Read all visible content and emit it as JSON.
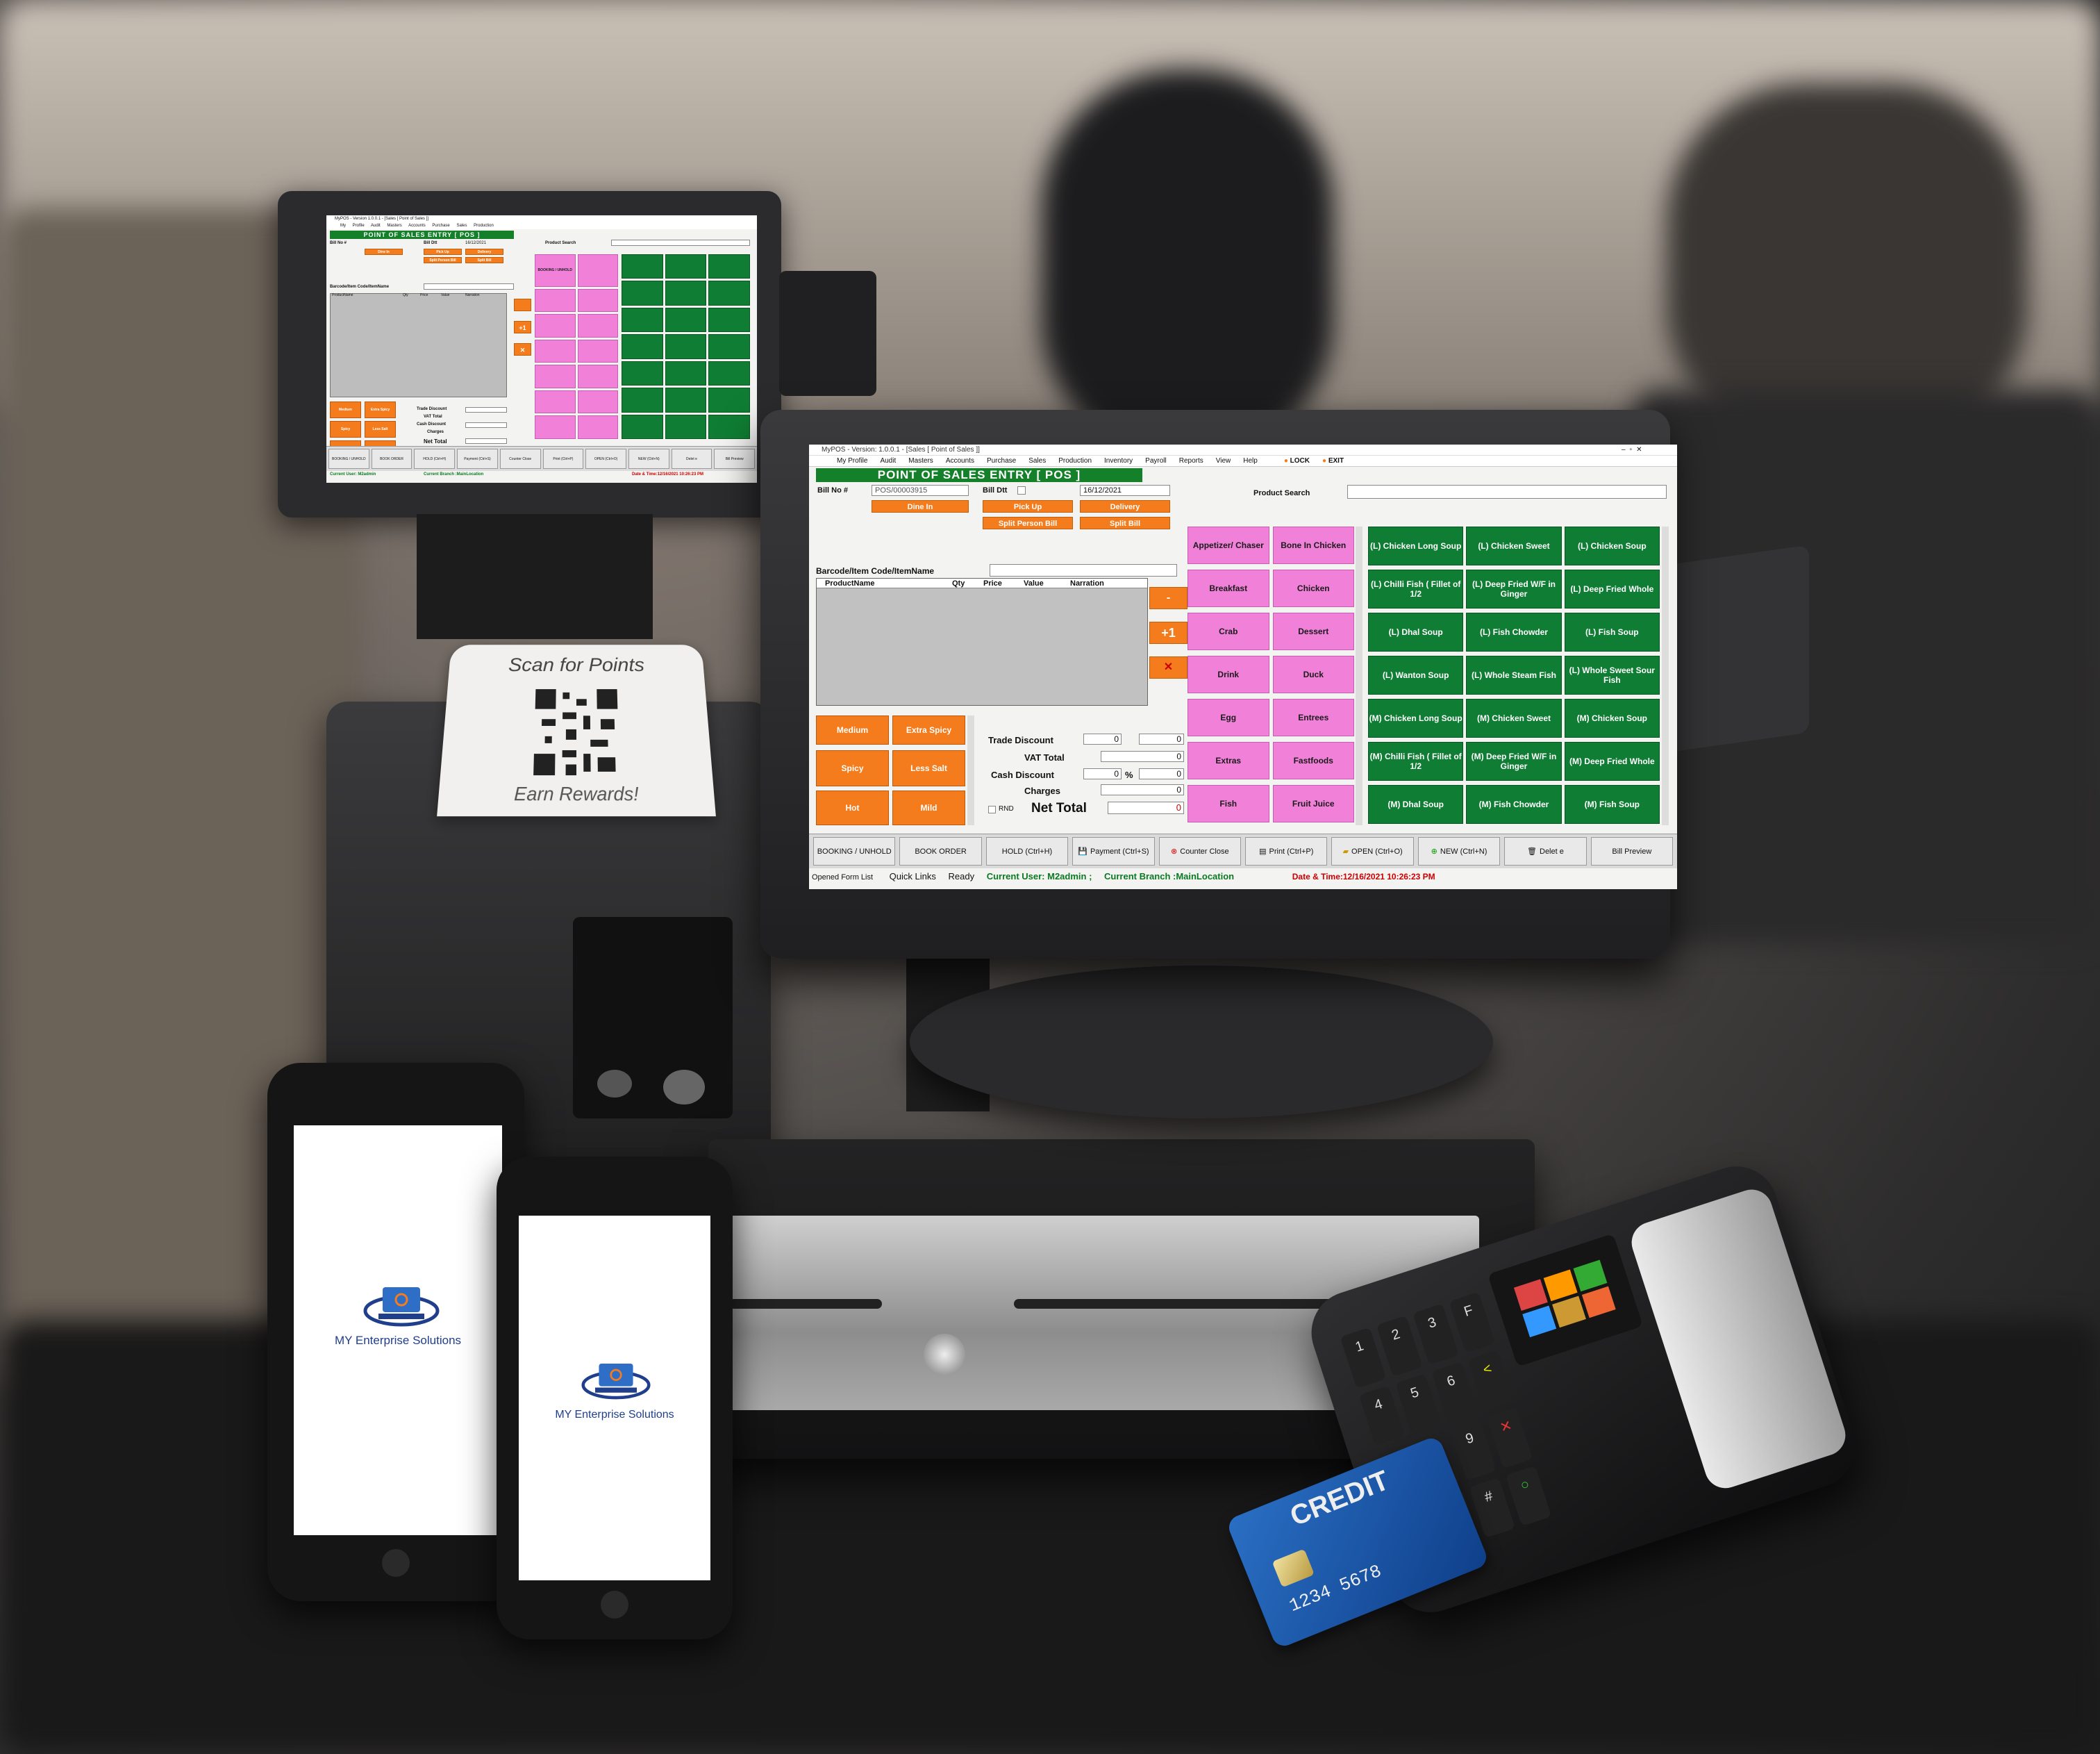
{
  "receipt": {
    "top_text": "Scan for Points",
    "bottom_text": "Earn Rewards!"
  },
  "phones": [
    {
      "brand": "MY Enterprise Solutions"
    },
    {
      "brand": "MY Enterprise Solutions"
    }
  ],
  "card": {
    "label": "CREDIT",
    "number": "1234 5678"
  },
  "pos": {
    "window_title": "MyPOS - Version: 1.0.0.1 - [Sales [ Point of Sales ]]",
    "menu": [
      "My Profile",
      "Audit",
      "Masters",
      "Accounts",
      "Purchase",
      "Sales",
      "Production",
      "Inventory",
      "Payroll",
      "Reports",
      "View",
      "Help"
    ],
    "lock": "LOCK",
    "exit": "EXIT",
    "header": "POINT OF SALES ENTRY [ POS ]",
    "bill_no_label": "Bill No #",
    "bill_no": "POS/00003915",
    "bill_dtt_label": "Bill Dtt",
    "date": "16/12/2021",
    "product_search_label": "Product Search",
    "order_types": [
      "Dine In",
      "Pick Up",
      "Delivery"
    ],
    "split_person": "Split Person Bill",
    "split_bill": "Split Bill",
    "barcode_label": "Barcode/Item Code/ItemName",
    "columns": [
      "ProductName",
      "Qty",
      "Price",
      "Value",
      "Narration"
    ],
    "qty_buttons": [
      "-",
      "+1",
      "✕"
    ],
    "modifiers": [
      "Medium",
      "Extra Spicy",
      "Spicy",
      "Less Salt",
      "Hot",
      "Mild"
    ],
    "totals": {
      "trade_discount_label": "Trade Discount",
      "trade_discount_a": "0",
      "trade_discount_b": "0",
      "vat_label": "VAT Total",
      "vat": "0",
      "cash_discount_label": "Cash Discount",
      "cash_discount": "0",
      "percent": "%",
      "cash_discount_amt": "0",
      "charges_label": "Charges",
      "charges": "0",
      "rnd": "RND",
      "net_label": "Net Total",
      "net": "0"
    },
    "categories": [
      "Appetizer/ Chaser",
      "Bone In Chicken",
      "Breakfast",
      "Chicken",
      "Crab",
      "Dessert",
      "Drink",
      "Duck",
      "Egg",
      "Entrees",
      "Extras",
      "Fastfoods",
      "Fish",
      "Fruit Juice"
    ],
    "items": [
      "(L) Chicken Long Soup",
      "(L) Chicken Sweet",
      "(L) Chicken Soup",
      "(L) Chilli Fish ( Fillet of 1/2",
      "(L) Deep Fried W/F in Ginger",
      "(L) Deep Fried Whole",
      "(L) Dhal Soup",
      "(L) Fish Chowder",
      "(L) Fish Soup",
      "(L) Wanton Soup",
      "(L) Whole Steam Fish",
      "(L) Whole Sweet Sour Fish",
      "(M) Chicken Long Soup",
      "(M) Chicken Sweet",
      "(M) Chicken Soup",
      "(M) Chilli Fish ( Fillet of 1/2",
      "(M) Deep Fried W/F in Ginger",
      "(M) Deep Fried Whole",
      "(M) Dhal Soup",
      "(M) Fish Chowder",
      "(M) Fish Soup"
    ],
    "toolbar": [
      "BOOKING / UNHOLD",
      "BOOK ORDER",
      "HOLD (Ctrl+H)",
      "Payment (Ctrl+S)",
      "Counter Close",
      "Print (Ctrl+P)",
      "OPEN (Ctrl+O)",
      "NEW (Ctrl+N)",
      "Delet e",
      "Bill Preview"
    ],
    "status": {
      "opened": "Opened Form List",
      "quick": "Quick Links",
      "ready": "Ready",
      "user": "Current User: M2admin ;",
      "branch": "Current Branch :MainLocation",
      "datetime": "Date & Time:12/16/2021 10:26:23 PM"
    }
  },
  "small_pos": {
    "header": "POINT OF SALES ENTRY [ POS ]",
    "title": "MyPOS - Version 1.0.0.1 - [Sales [ Point of Sales ]]",
    "menu": [
      "My Profile",
      "Audit",
      "Masters",
      "Accounts",
      "Purchase",
      "Sales",
      "Production",
      "Inventory",
      "Payroll",
      "Reports",
      "View",
      "Help"
    ],
    "bill_no": "Bill No #",
    "bill_dtt": "Bill Dtt",
    "date": "16/12/2021",
    "product_search": "Product Search",
    "barcode": "Barcode/Item Code/ItemName",
    "columns": [
      "ProductName",
      "Qty",
      "Price",
      "Value",
      "Narration"
    ],
    "order_btns": [
      "Dine In",
      "Pick Up",
      "Delivery",
      "Split Person Bill",
      "Split Bill"
    ],
    "modifiers": [
      "Medium",
      "Extra Spicy",
      "Spicy",
      "Less Salt",
      "Hot",
      "Mild"
    ],
    "totals": [
      "Trade Discount",
      "VAT Total",
      "Cash Discount",
      "Charges",
      "Net Total"
    ],
    "toolbar": [
      "BOOKING / UNHOLD",
      "BOOK ORDER",
      "HOLD (Ctrl+H)",
      "Payment (Ctrl+S)",
      "Counter Close",
      "Print (Ctrl+P)",
      "OPEN (Ctrl+O)",
      "NEW (Ctrl+N)",
      "Delet e",
      "Bill Preview"
    ],
    "status_user": "Current User: M2admin",
    "status_branch": "Current Branch :MainLocation",
    "status_date": "Date & Time:12/16/2021 10:26:23 PM"
  }
}
